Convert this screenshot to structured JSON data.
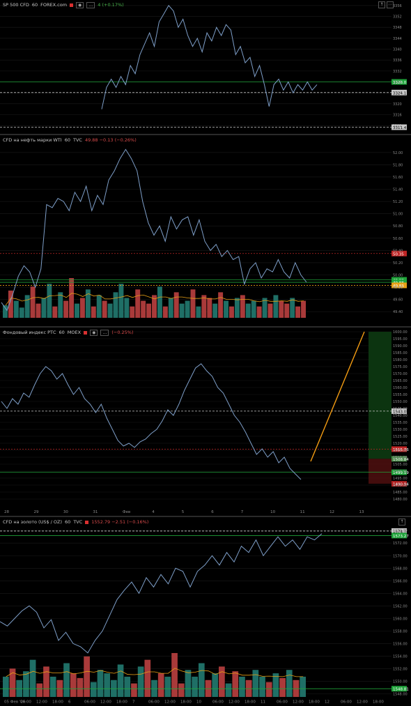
{
  "colors": {
    "line": "#7e9fc9",
    "up_vol": "#1f6f66",
    "down_vol": "#a93a3a",
    "green_level": "#1fa33a",
    "red_level": "#c02525",
    "orange_level": "#e8a015",
    "white_level": "#c8c8c8",
    "grid": "#1a1a1a",
    "axis_text": "#8a8a8a",
    "trend": "#f39c12"
  },
  "icons": {
    "flag": "flag-icon",
    "eye": "eye-icon",
    "more": "more-icon",
    "maximize": "maximize-icon",
    "settings": "settings-icon"
  },
  "panels": [
    {
      "id": "sp500",
      "header": {
        "symbol": "SP 500 CFD",
        "interval": "60",
        "source": "FOREX.com",
        "change": "4 (+0.17%)"
      },
      "chart_data": {
        "type": "line",
        "yticks": [
          3356,
          3352,
          3348,
          3344,
          3340,
          3336,
          3332,
          3328,
          3324,
          3320,
          3316,
          3312
        ],
        "ylim": [
          3310,
          3357
        ],
        "y": [
          3318,
          3326,
          3329,
          3326,
          3330,
          3327,
          3334,
          3331,
          3338,
          3342,
          3346,
          3341,
          3350,
          3353,
          3356,
          3354,
          3348,
          3351,
          3345,
          3341,
          3344,
          3339,
          3346,
          3343,
          3348,
          3345,
          3349,
          3347,
          3338,
          3341,
          3335,
          3337,
          3330,
          3334,
          3327,
          3319,
          3327,
          3329,
          3325,
          3328,
          3324,
          3327,
          3325,
          3328,
          3325,
          3327
        ],
        "levels": [
          {
            "value": 3328.0,
            "label": "3328.0",
            "color": "green"
          },
          {
            "value": 3324.1,
            "label": "3324.1",
            "color": "white"
          },
          {
            "value": 3311.4,
            "label": "3311.4",
            "color": "white"
          }
        ]
      }
    },
    {
      "id": "wti",
      "header": {
        "symbol": "CFD на нефть марки WTI",
        "interval": "60",
        "source": "TVC",
        "change": "49.88 −0.13 (−0.26%)"
      },
      "chart_data": {
        "type": "line",
        "yticks": [
          52.0,
          51.8,
          51.6,
          51.4,
          51.2,
          51.0,
          50.8,
          50.6,
          50.4,
          50.2,
          50.0,
          49.8,
          49.6,
          49.4
        ],
        "ylim": [
          49.3,
          52.1
        ],
        "y": [
          49.55,
          49.42,
          49.68,
          49.98,
          50.15,
          50.05,
          49.8,
          50.1,
          51.15,
          51.1,
          51.25,
          51.2,
          51.05,
          51.35,
          51.2,
          51.45,
          51.05,
          51.3,
          51.15,
          51.55,
          51.7,
          51.9,
          52.05,
          51.9,
          51.7,
          51.2,
          50.85,
          50.65,
          50.8,
          50.55,
          50.95,
          50.75,
          50.9,
          50.95,
          50.65,
          50.9,
          50.55,
          50.4,
          50.5,
          50.3,
          50.4,
          50.25,
          50.3,
          49.85,
          50.1,
          50.2,
          49.95,
          50.1,
          50.05,
          50.25,
          50.05,
          49.95,
          50.2,
          50.0,
          49.88
        ],
        "volume": [
          22,
          48,
          30,
          18,
          40,
          55,
          25,
          35,
          60,
          20,
          45,
          30,
          70,
          25,
          35,
          50,
          20,
          40,
          30,
          25,
          45,
          60,
          35,
          20,
          50,
          30,
          25,
          40,
          55,
          20,
          35,
          45,
          25,
          30,
          50,
          20,
          40,
          35,
          25,
          45,
          30,
          20,
          35,
          40,
          25,
          30,
          20,
          35,
          25,
          40,
          30,
          25,
          35,
          20,
          30
        ],
        "levels": [
          {
            "value": 50.35,
            "label": "50.35",
            "color": "red"
          },
          {
            "value": 49.92,
            "label": "49.92",
            "color": "green"
          },
          {
            "value": 49.88,
            "label": "49.88",
            "color": "green"
          },
          {
            "value": 49.83,
            "label": "49.83",
            "color": "orange"
          }
        ]
      }
    },
    {
      "id": "rts",
      "header": {
        "symbol": "Фондовый индекс РТС",
        "interval": "60",
        "source": "MOEX",
        "change": "(−0.25%)"
      },
      "chart_data": {
        "type": "line",
        "yticks": [
          1600.0,
          1595.0,
          1590.0,
          1585.0,
          1580.0,
          1575.0,
          1570.0,
          1565.0,
          1560.0,
          1555.0,
          1550.0,
          1545.0,
          1540.0,
          1535.0,
          1530.0,
          1525.0,
          1520.0,
          1515.0,
          1510.0,
          1505.0,
          1500.0,
          1495.0,
          1490.0,
          1485.0,
          1480.0
        ],
        "ylim": [
          1478,
          1601
        ],
        "xticks": [
          "28",
          "29",
          "30",
          "31",
          "Фев",
          "4",
          "5",
          "6",
          "7",
          "10",
          "11",
          "12",
          "13"
        ],
        "y": [
          1550,
          1545,
          1552,
          1548,
          1556,
          1553,
          1562,
          1570,
          1575,
          1572,
          1566,
          1570,
          1562,
          1555,
          1560,
          1552,
          1548,
          1542,
          1548,
          1538,
          1530,
          1522,
          1518,
          1520,
          1517,
          1521,
          1523,
          1527,
          1530,
          1536,
          1544,
          1540,
          1548,
          1558,
          1566,
          1574,
          1577,
          1572,
          1568,
          1560,
          1556,
          1548,
          1540,
          1535,
          1528,
          1520,
          1512,
          1516,
          1510,
          1514,
          1506,
          1510,
          1502,
          1498,
          1494
        ],
        "levels": [
          {
            "value": 1543.05,
            "label": "1543.05",
            "color": "white"
          },
          {
            "value": 1515.76,
            "label": "1515.76",
            "color": "red"
          },
          {
            "value": 1499.19,
            "label": "1499.19",
            "color": "green"
          }
        ],
        "zones": [
          {
            "from": 1508.84,
            "to": 1600,
            "color": "green"
          },
          {
            "from": 1490.94,
            "to": 1508.84,
            "color": "red"
          }
        ],
        "axis_tags": [
          {
            "value": 1508.84,
            "label": "1508.84"
          },
          {
            "value": 1490.94,
            "label": "1490.94"
          }
        ],
        "trend": {
          "from": 1507,
          "to": 1600
        }
      }
    },
    {
      "id": "gold",
      "header": {
        "symbol": "CFD на золото (US$ / OZ)",
        "interval": "60",
        "source": "TVC",
        "change": "1552.79 −2.51 (−0.16%)"
      },
      "chart_data": {
        "type": "line",
        "yticks": [
          1574.0,
          1572.0,
          1570.0,
          1568.0,
          1566.0,
          1564.0,
          1562.0,
          1560.0,
          1558.0,
          1556.0,
          1554.0,
          1552.0,
          1550.0,
          1548.0
        ],
        "ylim": [
          1547.5,
          1574.8
        ],
        "xticks": [
          "05 Фев '20",
          "06:00",
          "12:00",
          "18:00",
          "6",
          "06:00",
          "12:00",
          "18:00",
          "7",
          "06:00",
          "12:00",
          "18:00",
          "10",
          "06:00",
          "12:00",
          "18:00",
          "11",
          "06:00",
          "12:00",
          "18:00",
          "12",
          "06:00",
          "12:00",
          "18:00"
        ],
        "y": [
          1559.5,
          1558.8,
          1560.0,
          1561.2,
          1562.0,
          1561.0,
          1558.5,
          1559.8,
          1556.5,
          1557.8,
          1556.0,
          1555.5,
          1554.5,
          1556.5,
          1558.0,
          1560.5,
          1563.0,
          1564.5,
          1565.8,
          1564.0,
          1566.5,
          1565.0,
          1567.0,
          1565.5,
          1568.0,
          1567.5,
          1565.0,
          1567.5,
          1568.5,
          1570.0,
          1568.5,
          1570.5,
          1569.0,
          1571.5,
          1570.5,
          1572.5,
          1570.0,
          1571.5,
          1573.0,
          1571.5,
          1572.5,
          1571.0,
          1573.0,
          1572.5,
          1573.5
        ],
        "volume": [
          30,
          42,
          25,
          38,
          55,
          20,
          45,
          30,
          25,
          50,
          35,
          28,
          60,
          22,
          40,
          35,
          25,
          48,
          30,
          20,
          45,
          55,
          25,
          35,
          30,
          65,
          20,
          40,
          30,
          50,
          25,
          35,
          45,
          20,
          38,
          30,
          25,
          40,
          30,
          22,
          35,
          28,
          40,
          25,
          30
        ],
        "levels": [
          {
            "value": 1573.92,
            "label": "1574.74",
            "color": "white"
          },
          {
            "value": 1573.2,
            "label": "1573.27",
            "color": "green"
          },
          {
            "value": 1548.81,
            "label": "1548.81",
            "color": "green"
          }
        ]
      }
    }
  ]
}
